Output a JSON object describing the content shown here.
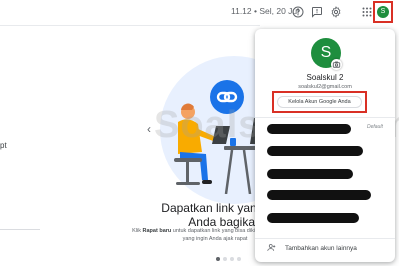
{
  "topbar": {
    "datetime": "11.12 • Sel, 20 Jul",
    "avatar_letter": "S",
    "icons": [
      "help-icon",
      "feedback-icon",
      "settings-icon",
      "apps-icon"
    ]
  },
  "left_fragment": "pt",
  "watermark": "Soalskul.com",
  "info": {
    "title": "Dapatkan link yang bisa Anda bagikan",
    "desc_prefix": "Klik ",
    "desc_bold": "Rapat baru",
    "desc_suffix": " untuk dapatkan link yang bisa dikirim kepada orang yang ingin Anda ajak rapat",
    "pager_count": 4,
    "pager_active": 0
  },
  "account_panel": {
    "avatar_letter": "S",
    "name": "Soalskul 2",
    "email": "soalskul2@gmail.com",
    "manage_button": "Kelola Akun Google Anda",
    "default_label": "Default",
    "add_account": "Tambahkan akun lainnya"
  },
  "colors": {
    "accent_blue": "#1a73e8",
    "avatar_green": "#1e8e3e",
    "highlight_red": "#d93025",
    "illustration_bg": "#e8f0fe"
  }
}
